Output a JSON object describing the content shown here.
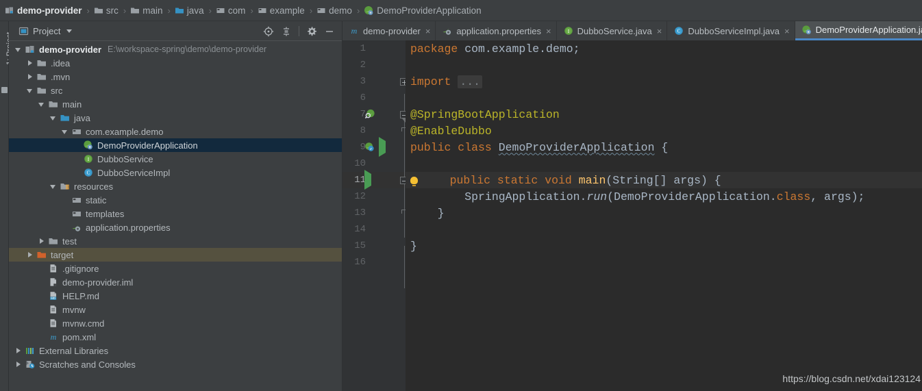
{
  "theme": {
    "panel_bg": "#3c3f41",
    "editor_bg": "#2b2b2b",
    "gutter_bg": "#313335",
    "selection_bg": "#12293d",
    "excluded_bg": "#55513f",
    "active_tab_bg": "#4e5254",
    "active_tab_underline": "#4a88c7",
    "accent_run_green": "#499c54",
    "keyword_orange": "#cc7832",
    "annotation_yellow": "#bbb529",
    "method_yellow": "#ffc66d",
    "text_default": "#a9b7c6"
  },
  "breadcrumb": {
    "items": [
      {
        "label": "demo-provider",
        "icon": "module-icon"
      },
      {
        "label": "src",
        "icon": "folder-icon"
      },
      {
        "label": "main",
        "icon": "folder-icon"
      },
      {
        "label": "java",
        "icon": "source-folder-icon"
      },
      {
        "label": "com",
        "icon": "package-icon"
      },
      {
        "label": "example",
        "icon": "package-icon"
      },
      {
        "label": "demo",
        "icon": "package-icon"
      },
      {
        "label": "DemoProviderApplication",
        "icon": "spring-class-icon"
      }
    ],
    "separator": "›"
  },
  "left_strip": {
    "label": "1: Project"
  },
  "project_panel": {
    "title": "Project",
    "actions": [
      {
        "name": "locate-in-tree-icon",
        "tooltip": "Select Opened File"
      },
      {
        "name": "collapse-all-icon",
        "tooltip": "Collapse All"
      },
      {
        "name": "gear-icon",
        "tooltip": "Settings"
      },
      {
        "name": "minimize-icon",
        "tooltip": "Hide"
      }
    ],
    "tree": [
      {
        "depth": 0,
        "twisty": "open",
        "icon": "module-icon",
        "label": "demo-provider",
        "sublabel": "E:\\workspace-spring\\demo\\demo-provider",
        "style": "root"
      },
      {
        "depth": 1,
        "twisty": "closed",
        "icon": "folder-icon",
        "label": ".idea",
        "style": ""
      },
      {
        "depth": 1,
        "twisty": "closed",
        "icon": "folder-icon",
        "label": ".mvn",
        "style": ""
      },
      {
        "depth": 1,
        "twisty": "open",
        "icon": "folder-icon",
        "label": "src",
        "style": ""
      },
      {
        "depth": 2,
        "twisty": "open",
        "icon": "folder-icon",
        "label": "main",
        "style": ""
      },
      {
        "depth": 3,
        "twisty": "open",
        "icon": "source-folder-icon",
        "label": "java",
        "style": ""
      },
      {
        "depth": 4,
        "twisty": "open",
        "icon": "package-icon",
        "label": "com.example.demo",
        "style": ""
      },
      {
        "depth": 5,
        "twisty": "none",
        "icon": "spring-class-icon",
        "label": "DemoProviderApplication",
        "style": "selected"
      },
      {
        "depth": 5,
        "twisty": "none",
        "icon": "interface-icon",
        "label": "DubboService",
        "style": ""
      },
      {
        "depth": 5,
        "twisty": "none",
        "icon": "class-icon",
        "label": "DubboServiceImpl",
        "style": ""
      },
      {
        "depth": 3,
        "twisty": "open",
        "icon": "resources-folder-icon",
        "label": "resources",
        "style": ""
      },
      {
        "depth": 4,
        "twisty": "none",
        "icon": "package-icon",
        "label": "static",
        "style": ""
      },
      {
        "depth": 4,
        "twisty": "none",
        "icon": "package-icon",
        "label": "templates",
        "style": ""
      },
      {
        "depth": 4,
        "twisty": "none",
        "icon": "spring-properties-icon",
        "label": "application.properties",
        "style": ""
      },
      {
        "depth": 2,
        "twisty": "closed",
        "icon": "folder-icon",
        "label": "test",
        "style": ""
      },
      {
        "depth": 1,
        "twisty": "closed",
        "icon": "excluded-folder-icon",
        "label": "target",
        "style": "excluded"
      },
      {
        "depth": 2,
        "twisty": "none",
        "icon": "file-icon",
        "label": ".gitignore",
        "style": ""
      },
      {
        "depth": 2,
        "twisty": "none",
        "icon": "iml-file-icon",
        "label": "demo-provider.iml",
        "style": ""
      },
      {
        "depth": 2,
        "twisty": "none",
        "icon": "markdown-file-icon",
        "label": "HELP.md",
        "style": ""
      },
      {
        "depth": 2,
        "twisty": "none",
        "icon": "file-icon",
        "label": "mvnw",
        "style": ""
      },
      {
        "depth": 2,
        "twisty": "none",
        "icon": "file-icon",
        "label": "mvnw.cmd",
        "style": ""
      },
      {
        "depth": 2,
        "twisty": "none",
        "icon": "maven-file-icon",
        "label": "pom.xml",
        "style": ""
      },
      {
        "depth": 0,
        "twisty": "closed",
        "icon": "external-libraries-icon",
        "label": "External Libraries",
        "style": ""
      },
      {
        "depth": 0,
        "twisty": "closed",
        "icon": "scratches-icon",
        "label": "Scratches and Consoles",
        "style": ""
      }
    ]
  },
  "editor": {
    "tabs": [
      {
        "label": "demo-provider",
        "icon": "maven-file-icon",
        "active": false,
        "close": "×"
      },
      {
        "label": "application.properties",
        "icon": "spring-properties-icon",
        "active": false,
        "close": "×"
      },
      {
        "label": "DubboService.java",
        "icon": "interface-icon",
        "active": false,
        "close": "×"
      },
      {
        "label": "DubboServiceImpl.java",
        "icon": "class-icon",
        "active": false,
        "close": "×"
      },
      {
        "label": "DemoProviderApplication.ja",
        "icon": "spring-class-icon",
        "active": true,
        "close": ""
      }
    ],
    "line_numbers": [
      "1",
      "2",
      "3",
      "6",
      "7",
      "8",
      "9",
      "10",
      "11",
      "12",
      "13",
      "14",
      "15",
      "16"
    ],
    "current_line": "11",
    "lines": [
      {
        "num": "1",
        "segments": [
          {
            "t": "package ",
            "c": "kw"
          },
          {
            "t": "com.example.demo;",
            "c": ""
          }
        ]
      },
      {
        "num": "2",
        "segments": []
      },
      {
        "num": "3",
        "segments": [
          {
            "t": "import ",
            "c": "kw"
          },
          {
            "t": "...",
            "c": "folded"
          }
        ]
      },
      {
        "num": "6",
        "segments": []
      },
      {
        "num": "7",
        "segments": [
          {
            "t": "@SpringBootApplication",
            "c": "ann"
          }
        ]
      },
      {
        "num": "8",
        "segments": [
          {
            "t": "@EnableDubbo",
            "c": "ann"
          }
        ]
      },
      {
        "num": "9",
        "segments": [
          {
            "t": "public class ",
            "c": "kw"
          },
          {
            "t": "DemoProviderApplication",
            "c": "wavy"
          },
          {
            "t": " {",
            "c": ""
          }
        ]
      },
      {
        "num": "10",
        "segments": []
      },
      {
        "num": "11",
        "segments": [
          {
            "t": "    public static void ",
            "c": "kw"
          },
          {
            "t": "main",
            "c": "mth"
          },
          {
            "t": "(String[] args) {",
            "c": ""
          }
        ]
      },
      {
        "num": "12",
        "segments": [
          {
            "t": "        SpringApplication.",
            "c": ""
          },
          {
            "t": "run",
            "c": "ital"
          },
          {
            "t": "(DemoProviderApplication.",
            "c": ""
          },
          {
            "t": "class",
            "c": "kw"
          },
          {
            "t": ", args);",
            "c": ""
          }
        ]
      },
      {
        "num": "13",
        "segments": [
          {
            "t": "    }",
            "c": ""
          }
        ]
      },
      {
        "num": "14",
        "segments": []
      },
      {
        "num": "15",
        "segments": [
          {
            "t": "}",
            "c": ""
          }
        ]
      },
      {
        "num": "16",
        "segments": []
      }
    ],
    "gutter_markers": [
      {
        "num": "7",
        "icons": [
          "spring-search-icon"
        ]
      },
      {
        "num": "9",
        "icons": [
          "spring-bean-icon",
          "run-icon"
        ]
      },
      {
        "num": "11",
        "icons": [
          "run-icon"
        ]
      }
    ],
    "inspection_bulb_line": "11",
    "watermark": "https://blog.csdn.net/xdai123124"
  }
}
